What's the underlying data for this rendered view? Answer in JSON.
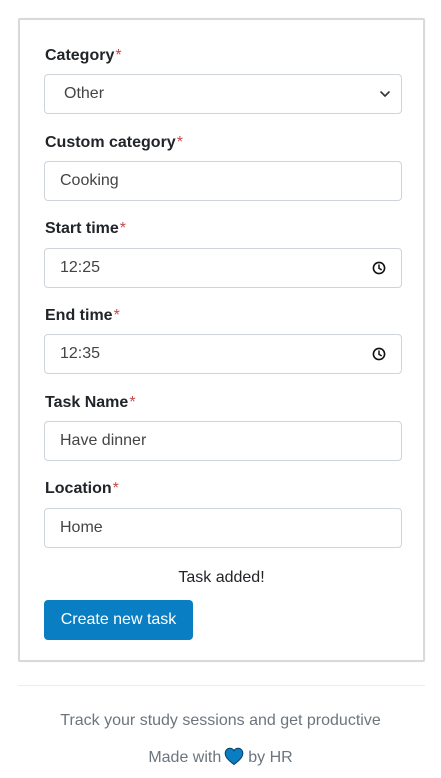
{
  "form": {
    "required_marker": "*",
    "category": {
      "label": "Category",
      "value": "Other"
    },
    "custom_category": {
      "label": "Custom category",
      "value": "Cooking"
    },
    "start_time": {
      "label": "Start time",
      "value": "12:25"
    },
    "end_time": {
      "label": "End time",
      "value": "12:35"
    },
    "task_name": {
      "label": "Task Name",
      "value": "Have dinner"
    },
    "location": {
      "label": "Location",
      "value": "Home"
    },
    "status_message": "Task added!",
    "submit_label": "Create new task"
  },
  "footer": {
    "tagline": "Track your study sessions and get productive",
    "made_with": "Made with",
    "by": "by HR"
  },
  "colors": {
    "button": "#0a7ec2",
    "required": "#c04b4b",
    "heart": "#0a7ec2"
  },
  "icons": {
    "select": "chevron-down-icon",
    "time": "clock-icon",
    "heart": "heart-icon"
  }
}
